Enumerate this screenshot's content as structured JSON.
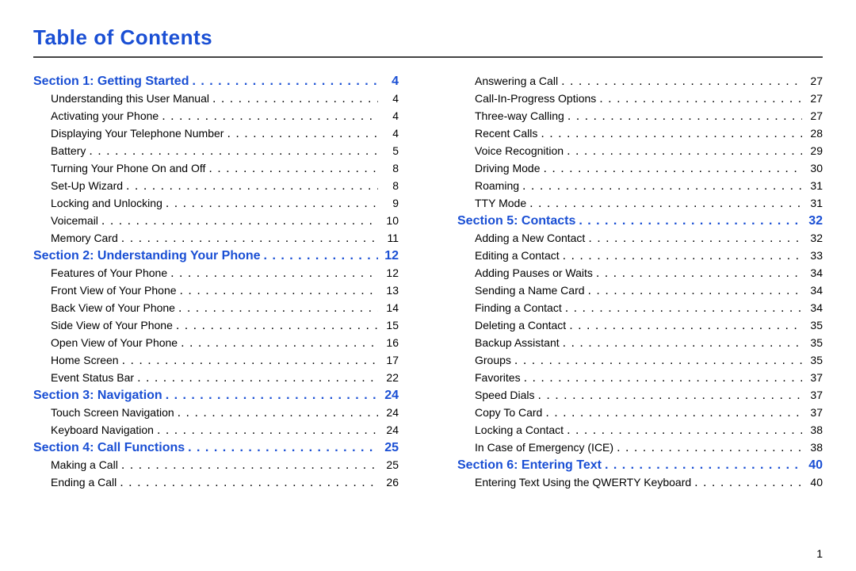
{
  "title": "Table of Contents",
  "page_number": "1",
  "columns": [
    [
      {
        "type": "section",
        "label": "Section 1:  Getting Started",
        "page": "4"
      },
      {
        "type": "sub",
        "label": "Understanding this User Manual",
        "page": "4"
      },
      {
        "type": "sub",
        "label": "Activating your Phone",
        "page": "4"
      },
      {
        "type": "sub",
        "label": "Displaying Your Telephone Number",
        "page": "4"
      },
      {
        "type": "sub",
        "label": "Battery",
        "page": "5"
      },
      {
        "type": "sub",
        "label": "Turning Your Phone On and Off",
        "page": "8"
      },
      {
        "type": "sub",
        "label": "Set-Up Wizard",
        "page": "8"
      },
      {
        "type": "sub",
        "label": "Locking and Unlocking",
        "page": "9"
      },
      {
        "type": "sub",
        "label": "Voicemail",
        "page": "10"
      },
      {
        "type": "sub",
        "label": "Memory Card",
        "page": "11"
      },
      {
        "type": "section",
        "label": "Section 2:  Understanding Your Phone",
        "page": "12"
      },
      {
        "type": "sub",
        "label": "Features of Your Phone",
        "page": "12"
      },
      {
        "type": "sub",
        "label": "Front View of Your Phone",
        "page": "13"
      },
      {
        "type": "sub",
        "label": "Back View of Your Phone",
        "page": "14"
      },
      {
        "type": "sub",
        "label": "Side View of Your Phone",
        "page": "15"
      },
      {
        "type": "sub",
        "label": "Open View of Your Phone",
        "page": "16"
      },
      {
        "type": "sub",
        "label": "Home Screen",
        "page": "17"
      },
      {
        "type": "sub",
        "label": "Event Status Bar",
        "page": "22"
      },
      {
        "type": "section",
        "label": "Section 3:  Navigation",
        "page": "24"
      },
      {
        "type": "sub",
        "label": "Touch Screen Navigation",
        "page": "24"
      },
      {
        "type": "sub",
        "label": "Keyboard Navigation",
        "page": "24"
      },
      {
        "type": "section",
        "label": "Section 4:  Call Functions",
        "page": "25"
      },
      {
        "type": "sub",
        "label": "Making a Call",
        "page": "25"
      },
      {
        "type": "sub",
        "label": "Ending a Call",
        "page": "26"
      }
    ],
    [
      {
        "type": "sub",
        "label": "Answering a Call",
        "page": "27"
      },
      {
        "type": "sub",
        "label": "Call-In-Progress Options",
        "page": "27"
      },
      {
        "type": "sub",
        "label": "Three-way Calling",
        "page": "27"
      },
      {
        "type": "sub",
        "label": "Recent Calls",
        "page": "28"
      },
      {
        "type": "sub",
        "label": "Voice Recognition",
        "page": "29"
      },
      {
        "type": "sub",
        "label": "Driving Mode",
        "page": "30"
      },
      {
        "type": "sub",
        "label": "Roaming",
        "page": "31"
      },
      {
        "type": "sub",
        "label": "TTY Mode",
        "page": "31"
      },
      {
        "type": "section",
        "label": "Section 5:  Contacts",
        "page": "32"
      },
      {
        "type": "sub",
        "label": "Adding a New Contact",
        "page": "32"
      },
      {
        "type": "sub",
        "label": "Editing a Contact",
        "page": "33"
      },
      {
        "type": "sub",
        "label": "Adding Pauses or Waits",
        "page": "34"
      },
      {
        "type": "sub",
        "label": "Sending a Name Card",
        "page": "34"
      },
      {
        "type": "sub",
        "label": "Finding a Contact",
        "page": "34"
      },
      {
        "type": "sub",
        "label": "Deleting a Contact",
        "page": "35"
      },
      {
        "type": "sub",
        "label": "Backup Assistant",
        "page": "35"
      },
      {
        "type": "sub",
        "label": "Groups",
        "page": "35"
      },
      {
        "type": "sub",
        "label": "Favorites",
        "page": "37"
      },
      {
        "type": "sub",
        "label": "Speed Dials",
        "page": "37"
      },
      {
        "type": "sub",
        "label": "Copy To Card",
        "page": "37"
      },
      {
        "type": "sub",
        "label": "Locking a Contact",
        "page": "38"
      },
      {
        "type": "sub",
        "label": "In Case of Emergency (ICE)",
        "page": "38"
      },
      {
        "type": "section",
        "label": "Section 6:  Entering Text",
        "page": "40"
      },
      {
        "type": "sub",
        "label": "Entering Text Using the QWERTY Keyboard",
        "page": "40"
      }
    ]
  ]
}
